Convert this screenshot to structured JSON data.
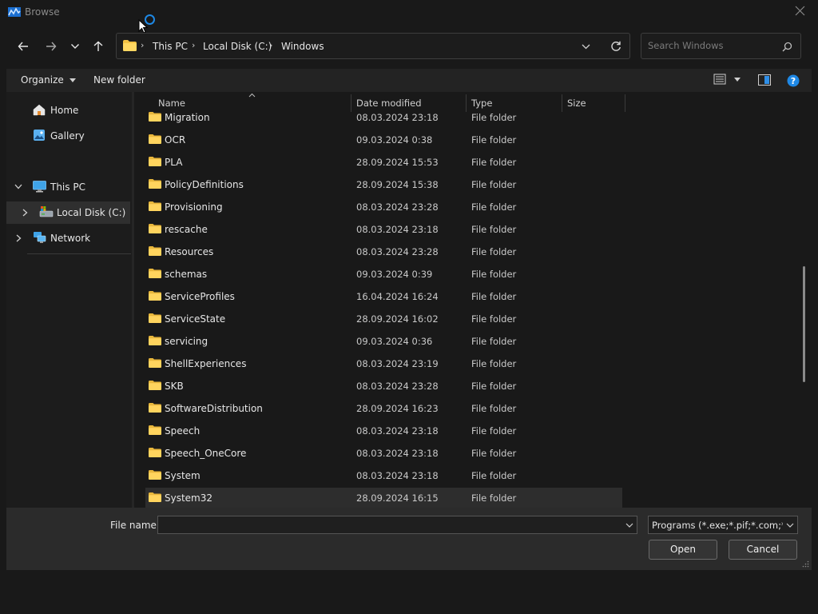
{
  "window": {
    "title": "Browse",
    "close_icon": "close-icon",
    "app_icon": "app-icon"
  },
  "nav": {
    "back_icon": "arrow-left-icon",
    "forward_icon": "arrow-right-icon",
    "recent_icon": "chevron-down-icon",
    "up_icon": "arrow-up-icon"
  },
  "address": {
    "crumbs": [
      "This PC",
      "Local Disk (C:)",
      "Windows"
    ],
    "folder_icon": "folder-icon",
    "refresh_icon": "refresh-icon"
  },
  "search": {
    "placeholder": "Search Windows",
    "icon": "search-icon"
  },
  "toolbar": {
    "organize_label": "Organize",
    "new_folder_label": "New folder",
    "view_icon": "view-details-icon",
    "preview_icon": "preview-pane-icon",
    "help_icon": "help-icon",
    "help_color": "#1e88e5"
  },
  "navpane": {
    "home": "Home",
    "gallery": "Gallery",
    "this_pc": "This PC",
    "local_disk": "Local Disk (C:)",
    "network": "Network"
  },
  "columns": {
    "name": "Name",
    "date": "Date modified",
    "type": "Type",
    "size": "Size"
  },
  "files": [
    {
      "name": "Migration",
      "date": "08.03.2024 23:18",
      "type": "File folder"
    },
    {
      "name": "OCR",
      "date": "09.03.2024 0:38",
      "type": "File folder"
    },
    {
      "name": "PLA",
      "date": "28.09.2024 15:53",
      "type": "File folder"
    },
    {
      "name": "PolicyDefinitions",
      "date": "28.09.2024 15:38",
      "type": "File folder"
    },
    {
      "name": "Provisioning",
      "date": "08.03.2024 23:28",
      "type": "File folder"
    },
    {
      "name": "rescache",
      "date": "08.03.2024 23:18",
      "type": "File folder"
    },
    {
      "name": "Resources",
      "date": "08.03.2024 23:28",
      "type": "File folder"
    },
    {
      "name": "schemas",
      "date": "09.03.2024 0:39",
      "type": "File folder"
    },
    {
      "name": "ServiceProfiles",
      "date": "16.04.2024 16:24",
      "type": "File folder"
    },
    {
      "name": "ServiceState",
      "date": "28.09.2024 16:02",
      "type": "File folder"
    },
    {
      "name": "servicing",
      "date": "09.03.2024 0:36",
      "type": "File folder"
    },
    {
      "name": "ShellExperiences",
      "date": "08.03.2024 23:19",
      "type": "File folder"
    },
    {
      "name": "SKB",
      "date": "08.03.2024 23:28",
      "type": "File folder"
    },
    {
      "name": "SoftwareDistribution",
      "date": "28.09.2024 16:23",
      "type": "File folder"
    },
    {
      "name": "Speech",
      "date": "08.03.2024 23:18",
      "type": "File folder"
    },
    {
      "name": "Speech_OneCore",
      "date": "08.03.2024 23:18",
      "type": "File folder"
    },
    {
      "name": "System",
      "date": "08.03.2024 23:18",
      "type": "File folder"
    },
    {
      "name": "System32",
      "date": "28.09.2024 16:15",
      "type": "File folder",
      "selected": true
    }
  ],
  "bottom": {
    "file_name_label": "File name:",
    "file_name_value": "",
    "filter_value": "Programs (*.exe;*.pif;*.com;*.bat;*.cmd)",
    "open_label": "Open",
    "cancel_label": "Cancel"
  }
}
